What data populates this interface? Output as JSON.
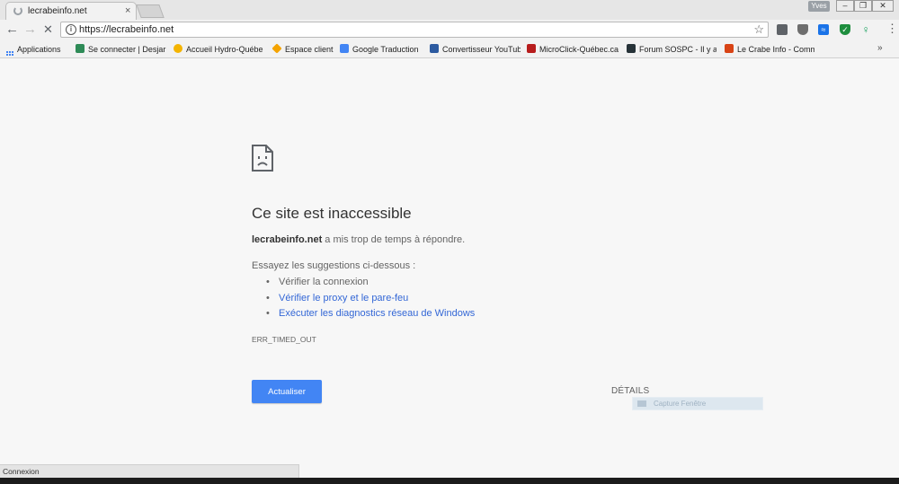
{
  "window": {
    "tab_title": "lecrabeinfo.net",
    "tab_close": "×",
    "profile_label": "Yves",
    "minimize_glyph": "–",
    "maximize_glyph": "❐",
    "close_glyph": "✕"
  },
  "toolbar": {
    "back_icon": "←",
    "forward_icon": "→",
    "stop_icon": "✕",
    "url": "https://lecrabeinfo.net",
    "star_icon": "☆",
    "menu_icon": "⋮",
    "extensions": [
      {
        "icon": "page-icon",
        "color": "#5f6368"
      },
      {
        "icon": "shield-icon",
        "color": "#6d6d6d"
      },
      {
        "icon": "waves-icon",
        "color": "#1a73e8"
      },
      {
        "icon": "shield-check-icon",
        "color": "#1e8e3e"
      },
      {
        "icon": "key-icon",
        "color": "#0f9d58"
      },
      {
        "icon": "puzzle-icon",
        "color": "#34a853"
      }
    ]
  },
  "bookmarks": {
    "items": [
      {
        "label": "Applications",
        "icon": "apps-icon",
        "color": "#4285f4"
      },
      {
        "label": "Se connecter | Desjar",
        "icon": "desjardins-icon",
        "color": "#2e8b57"
      },
      {
        "label": "Accueil Hydro-Québe",
        "icon": "search-icon",
        "color": "#f4b400"
      },
      {
        "label": "Espace client",
        "icon": "diamond-icon",
        "color": "#f4a300"
      },
      {
        "label": "Google Traduction",
        "icon": "translate-icon",
        "color": "#4285f4"
      },
      {
        "label": "Convertisseur YouTub",
        "icon": "youtube-converter-icon",
        "color": "#2c5aa0"
      },
      {
        "label": "MicroClick-Québec.ca",
        "icon": "microclick-icon",
        "color": "#b71c1c"
      },
      {
        "label": "Forum SOSPC - Il y a",
        "icon": "forum-icon",
        "color": "#263238"
      },
      {
        "label": "Le Crabe Info - Comm",
        "icon": "crab-icon",
        "color": "#d84315"
      }
    ],
    "more_icon": "»"
  },
  "error_page": {
    "title": "Ce site est inaccessible",
    "host": "lecrabeinfo.net",
    "host_message": " a mis trop de temps à répondre.",
    "suggestions_heading": "Essayez les suggestions ci-dessous :",
    "suggestions": [
      "Vérifier la connexion",
      "Vérifier le proxy et le pare-feu",
      "Exécuter les diagnostics réseau de Windows"
    ],
    "error_code": "ERR_TIMED_OUT",
    "reload_label": "Actualiser",
    "details_label": "DÉTAILS",
    "capture_label": "Capture Fenêtre"
  },
  "status_bar": {
    "text": "Connexion"
  },
  "colors": {
    "accent": "#4285f4",
    "link": "#3367d6",
    "page_bg": "#f7f7f7"
  }
}
